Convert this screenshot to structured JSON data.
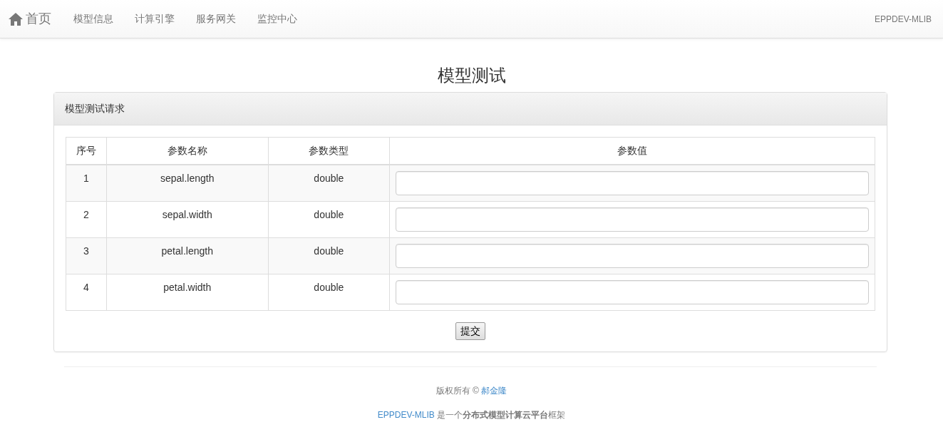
{
  "navbar": {
    "brand": "首页",
    "items": [
      "模型信息",
      "计算引擎",
      "服务网关",
      "监控中心"
    ],
    "right": "EPPDEV-MLIB"
  },
  "page_title": "模型测试",
  "panel": {
    "title": "模型测试请求",
    "table": {
      "columns": [
        "序号",
        "参数名称",
        "参数类型",
        "参数值"
      ],
      "rows": [
        {
          "index": "1",
          "name": "sepal.length",
          "type": "double"
        },
        {
          "index": "2",
          "name": "sepal.width",
          "type": "double"
        },
        {
          "index": "3",
          "name": "petal.length",
          "type": "double"
        },
        {
          "index": "4",
          "name": "petal.width",
          "type": "double"
        }
      ]
    },
    "submit": "提交"
  },
  "footer": {
    "copyright": "版权所有 © ",
    "author": "郝金隆",
    "project_link": "EPPDEV-MLIB",
    "description": " 是一个**分布式模型计算云平台**框架"
  }
}
